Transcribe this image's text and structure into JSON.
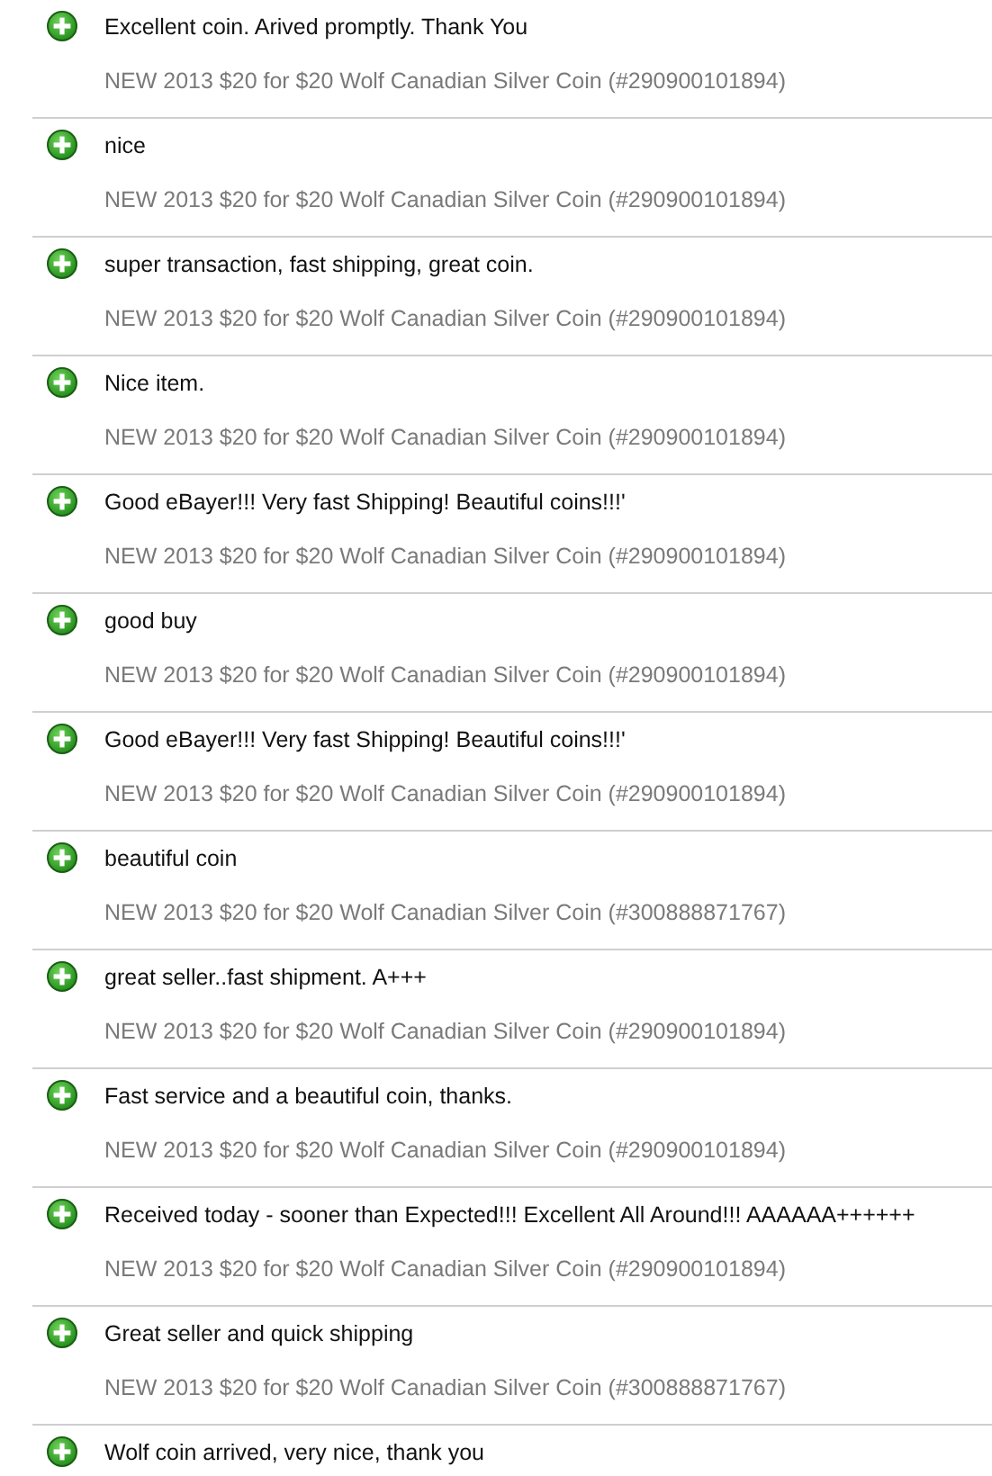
{
  "feedback": [
    {
      "comment": "Excellent coin. Arived promptly. Thank You",
      "item": "NEW 2013 $20 for $20 Wolf Canadian Silver Coin (#290900101894)"
    },
    {
      "comment": "nice",
      "item": "NEW 2013 $20 for $20 Wolf Canadian Silver Coin (#290900101894)"
    },
    {
      "comment": "super transaction, fast shipping, great coin.",
      "item": "NEW 2013 $20 for $20 Wolf Canadian Silver Coin (#290900101894)"
    },
    {
      "comment": "Nice item.",
      "item": "NEW 2013 $20 for $20 Wolf Canadian Silver Coin (#290900101894)"
    },
    {
      "comment": "Good eBayer!!! Very fast Shipping! Beautiful coins!!!'",
      "item": "NEW 2013 $20 for $20 Wolf Canadian Silver Coin (#290900101894)"
    },
    {
      "comment": "good buy",
      "item": "NEW 2013 $20 for $20 Wolf Canadian Silver Coin (#290900101894)"
    },
    {
      "comment": "Good eBayer!!! Very fast Shipping! Beautiful coins!!!'",
      "item": "NEW 2013 $20 for $20 Wolf Canadian Silver Coin (#290900101894)"
    },
    {
      "comment": "beautiful coin",
      "item": "NEW 2013 $20 for $20 Wolf Canadian Silver Coin (#300888871767)"
    },
    {
      "comment": "great seller..fast shipment. A+++",
      "item": "NEW 2013 $20 for $20 Wolf Canadian Silver Coin (#290900101894)"
    },
    {
      "comment": "Fast service and a beautiful coin, thanks.",
      "item": "NEW 2013 $20 for $20 Wolf Canadian Silver Coin (#290900101894)"
    },
    {
      "comment": "Received today - sooner than Expected!!! Excellent All Around!!! AAAAAA++++++",
      "item": "NEW 2013 $20 for $20 Wolf Canadian Silver Coin (#290900101894)"
    },
    {
      "comment": "Great seller and quick shipping",
      "item": "NEW 2013 $20 for $20 Wolf Canadian Silver Coin (#300888871767)"
    },
    {
      "comment": "Wolf coin arrived, very nice, thank you"
    }
  ]
}
